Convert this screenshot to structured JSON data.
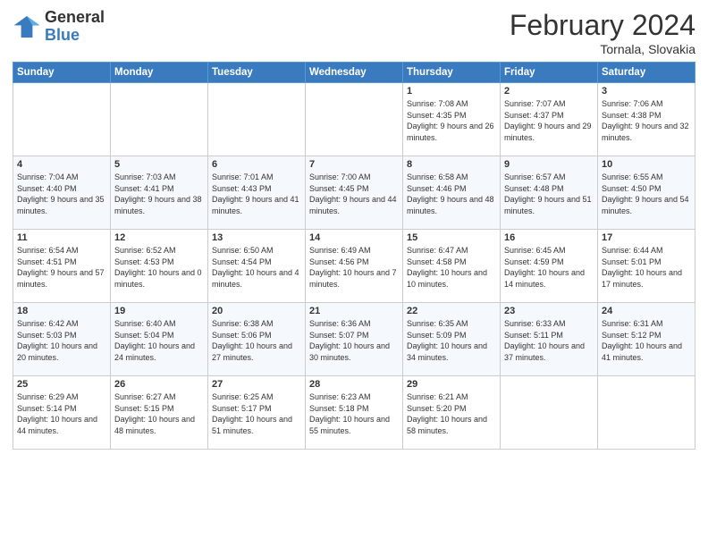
{
  "logo": {
    "general": "General",
    "blue": "Blue"
  },
  "title": "February 2024",
  "location": "Tornala, Slovakia",
  "days_of_week": [
    "Sunday",
    "Monday",
    "Tuesday",
    "Wednesday",
    "Thursday",
    "Friday",
    "Saturday"
  ],
  "weeks": [
    [
      {
        "day": "",
        "info": ""
      },
      {
        "day": "",
        "info": ""
      },
      {
        "day": "",
        "info": ""
      },
      {
        "day": "",
        "info": ""
      },
      {
        "day": "1",
        "info": "Sunrise: 7:08 AM\nSunset: 4:35 PM\nDaylight: 9 hours\nand 26 minutes."
      },
      {
        "day": "2",
        "info": "Sunrise: 7:07 AM\nSunset: 4:37 PM\nDaylight: 9 hours\nand 29 minutes."
      },
      {
        "day": "3",
        "info": "Sunrise: 7:06 AM\nSunset: 4:38 PM\nDaylight: 9 hours\nand 32 minutes."
      }
    ],
    [
      {
        "day": "4",
        "info": "Sunrise: 7:04 AM\nSunset: 4:40 PM\nDaylight: 9 hours\nand 35 minutes."
      },
      {
        "day": "5",
        "info": "Sunrise: 7:03 AM\nSunset: 4:41 PM\nDaylight: 9 hours\nand 38 minutes."
      },
      {
        "day": "6",
        "info": "Sunrise: 7:01 AM\nSunset: 4:43 PM\nDaylight: 9 hours\nand 41 minutes."
      },
      {
        "day": "7",
        "info": "Sunrise: 7:00 AM\nSunset: 4:45 PM\nDaylight: 9 hours\nand 44 minutes."
      },
      {
        "day": "8",
        "info": "Sunrise: 6:58 AM\nSunset: 4:46 PM\nDaylight: 9 hours\nand 48 minutes."
      },
      {
        "day": "9",
        "info": "Sunrise: 6:57 AM\nSunset: 4:48 PM\nDaylight: 9 hours\nand 51 minutes."
      },
      {
        "day": "10",
        "info": "Sunrise: 6:55 AM\nSunset: 4:50 PM\nDaylight: 9 hours\nand 54 minutes."
      }
    ],
    [
      {
        "day": "11",
        "info": "Sunrise: 6:54 AM\nSunset: 4:51 PM\nDaylight: 9 hours\nand 57 minutes."
      },
      {
        "day": "12",
        "info": "Sunrise: 6:52 AM\nSunset: 4:53 PM\nDaylight: 10 hours\nand 0 minutes."
      },
      {
        "day": "13",
        "info": "Sunrise: 6:50 AM\nSunset: 4:54 PM\nDaylight: 10 hours\nand 4 minutes."
      },
      {
        "day": "14",
        "info": "Sunrise: 6:49 AM\nSunset: 4:56 PM\nDaylight: 10 hours\nand 7 minutes."
      },
      {
        "day": "15",
        "info": "Sunrise: 6:47 AM\nSunset: 4:58 PM\nDaylight: 10 hours\nand 10 minutes."
      },
      {
        "day": "16",
        "info": "Sunrise: 6:45 AM\nSunset: 4:59 PM\nDaylight: 10 hours\nand 14 minutes."
      },
      {
        "day": "17",
        "info": "Sunrise: 6:44 AM\nSunset: 5:01 PM\nDaylight: 10 hours\nand 17 minutes."
      }
    ],
    [
      {
        "day": "18",
        "info": "Sunrise: 6:42 AM\nSunset: 5:03 PM\nDaylight: 10 hours\nand 20 minutes."
      },
      {
        "day": "19",
        "info": "Sunrise: 6:40 AM\nSunset: 5:04 PM\nDaylight: 10 hours\nand 24 minutes."
      },
      {
        "day": "20",
        "info": "Sunrise: 6:38 AM\nSunset: 5:06 PM\nDaylight: 10 hours\nand 27 minutes."
      },
      {
        "day": "21",
        "info": "Sunrise: 6:36 AM\nSunset: 5:07 PM\nDaylight: 10 hours\nand 30 minutes."
      },
      {
        "day": "22",
        "info": "Sunrise: 6:35 AM\nSunset: 5:09 PM\nDaylight: 10 hours\nand 34 minutes."
      },
      {
        "day": "23",
        "info": "Sunrise: 6:33 AM\nSunset: 5:11 PM\nDaylight: 10 hours\nand 37 minutes."
      },
      {
        "day": "24",
        "info": "Sunrise: 6:31 AM\nSunset: 5:12 PM\nDaylight: 10 hours\nand 41 minutes."
      }
    ],
    [
      {
        "day": "25",
        "info": "Sunrise: 6:29 AM\nSunset: 5:14 PM\nDaylight: 10 hours\nand 44 minutes."
      },
      {
        "day": "26",
        "info": "Sunrise: 6:27 AM\nSunset: 5:15 PM\nDaylight: 10 hours\nand 48 minutes."
      },
      {
        "day": "27",
        "info": "Sunrise: 6:25 AM\nSunset: 5:17 PM\nDaylight: 10 hours\nand 51 minutes."
      },
      {
        "day": "28",
        "info": "Sunrise: 6:23 AM\nSunset: 5:18 PM\nDaylight: 10 hours\nand 55 minutes."
      },
      {
        "day": "29",
        "info": "Sunrise: 6:21 AM\nSunset: 5:20 PM\nDaylight: 10 hours\nand 58 minutes."
      },
      {
        "day": "",
        "info": ""
      },
      {
        "day": "",
        "info": ""
      }
    ]
  ]
}
